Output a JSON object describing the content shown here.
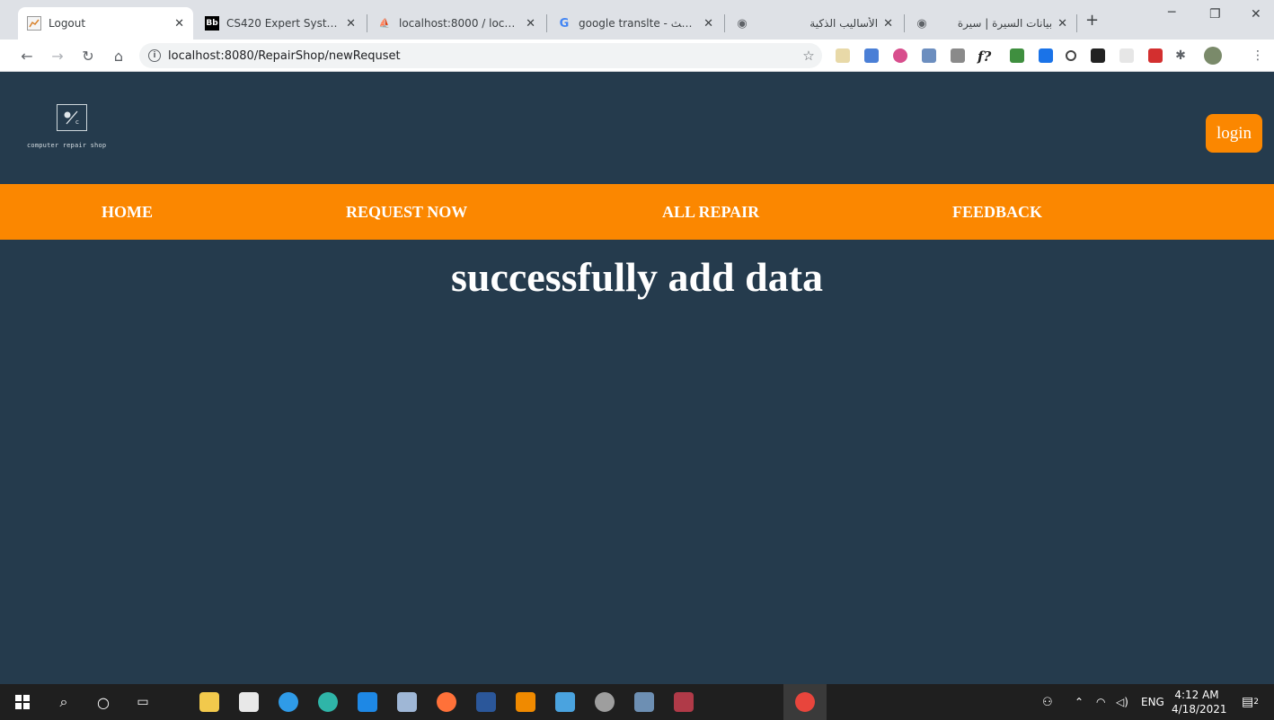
{
  "browser": {
    "tabs": [
      {
        "title": "Logout",
        "favicon": "chart-favicon",
        "active": true
      },
      {
        "title": "CS420 Expert Systems -",
        "favicon": "bb-favicon",
        "active": false
      },
      {
        "title": "localhost:8000 / localho",
        "favicon": "phpmyadmin-favicon",
        "active": false
      },
      {
        "title": "google translte - بحث G",
        "favicon": "google-favicon",
        "active": false
      },
      {
        "title": "الأساليب الذكية",
        "favicon": "globe-favicon",
        "active": false
      },
      {
        "title": "بيانات السيرة | سيرة",
        "favicon": "globe-favicon",
        "active": false
      }
    ],
    "new_tab": "+",
    "url": "localhost:8080/RepairShop/newRequset"
  },
  "site": {
    "logo_text": "computer repair shop",
    "login_label": "login",
    "nav": [
      "HOME",
      "REQUEST NOW",
      "ALL REPAIR",
      "FEEDBACK"
    ],
    "message": "successfully add data",
    "colors": {
      "background": "#253b4d",
      "accent": "#fb8700",
      "text": "#ffffff"
    }
  },
  "taskbar": {
    "lang": "ENG",
    "time": "4:12 AM",
    "date": "4/18/2021",
    "notification_count": "2"
  }
}
